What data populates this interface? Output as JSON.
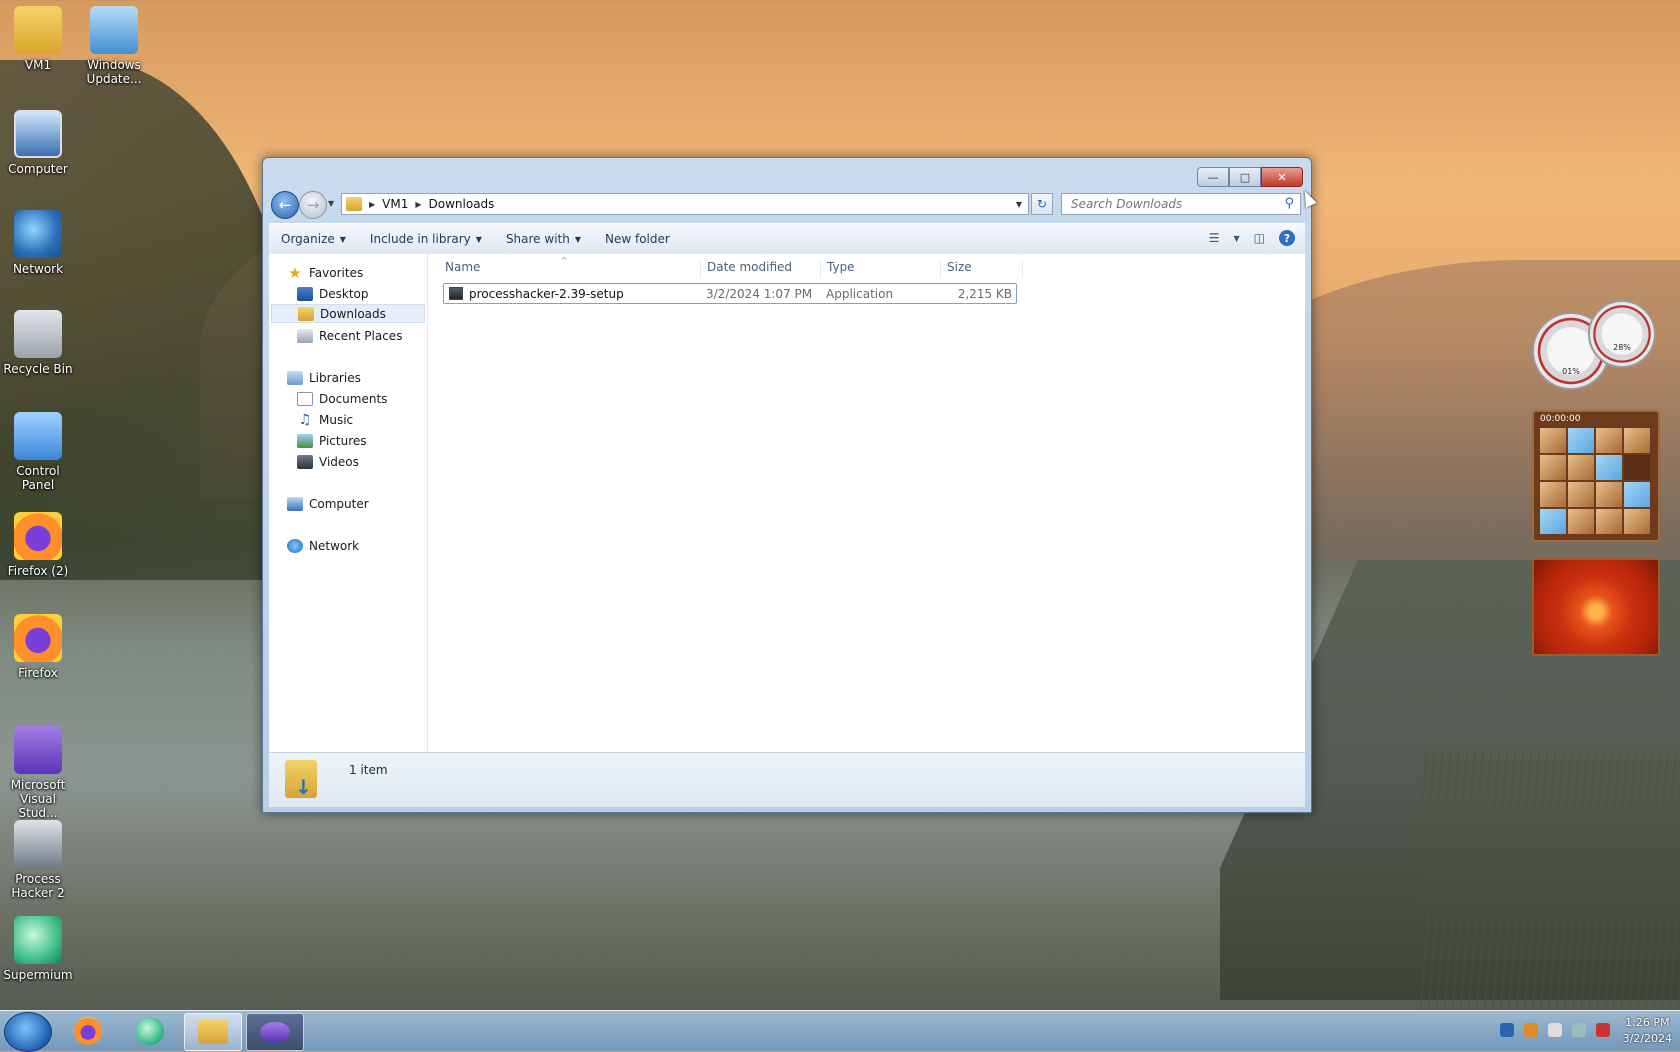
{
  "desktop": {
    "icons": [
      {
        "label": "VM1",
        "icon": "user-folder-icon"
      },
      {
        "label": "Windows Update...",
        "icon": "windows-update-icon"
      },
      {
        "label": "Computer",
        "icon": "computer-icon"
      },
      {
        "label": "Network",
        "icon": "network-icon"
      },
      {
        "label": "Recycle Bin",
        "icon": "recycle-bin-icon"
      },
      {
        "label": "Control Panel",
        "icon": "control-panel-icon"
      },
      {
        "label": "Firefox (2)",
        "icon": "firefox-icon"
      },
      {
        "label": "Firefox",
        "icon": "firefox-icon"
      },
      {
        "label": "Microsoft Visual Stud...",
        "icon": "visual-studio-icon"
      },
      {
        "label": "Process Hacker 2",
        "icon": "process-hacker-icon"
      },
      {
        "label": "Supermium",
        "icon": "supermium-icon"
      }
    ]
  },
  "explorer": {
    "address": {
      "crumbs": [
        "VM1",
        "Downloads"
      ]
    },
    "search": {
      "placeholder": "Search Downloads"
    },
    "toolbar": {
      "organize": "Organize",
      "include_in_library": "Include in library",
      "share_with": "Share with",
      "new_folder": "New folder"
    },
    "nav_pane": {
      "favorites": {
        "label": "Favorites",
        "items": [
          "Desktop",
          "Downloads",
          "Recent Places"
        ]
      },
      "libraries": {
        "label": "Libraries",
        "items": [
          "Documents",
          "Music",
          "Pictures",
          "Videos"
        ]
      },
      "computer": "Computer",
      "network": "Network",
      "selected": "Downloads"
    },
    "columns": {
      "name": "Name",
      "date_modified": "Date modified",
      "type": "Type",
      "size": "Size"
    },
    "files": [
      {
        "name": "processhacker-2.39-setup",
        "date_modified": "3/2/2024 1:07 PM",
        "type": "Application",
        "size": "2,215 KB"
      }
    ],
    "status": {
      "item_count": "1 item"
    }
  },
  "gadgets": {
    "cpu_meter": {
      "cpu": "01%",
      "memory": "28%"
    },
    "puzzle": {
      "timer": "00:00:00"
    }
  },
  "taskbar": {
    "apps": [
      "firefox-icon",
      "supermium-icon",
      "explorer-icon",
      "visual-studio-icon"
    ],
    "clock": {
      "time": "1:26 PM",
      "date": "3/2/2024"
    }
  },
  "colors": {
    "accent": "#2a64b0",
    "close_button": "#c0382b",
    "selection_border": "#7da2ce"
  }
}
